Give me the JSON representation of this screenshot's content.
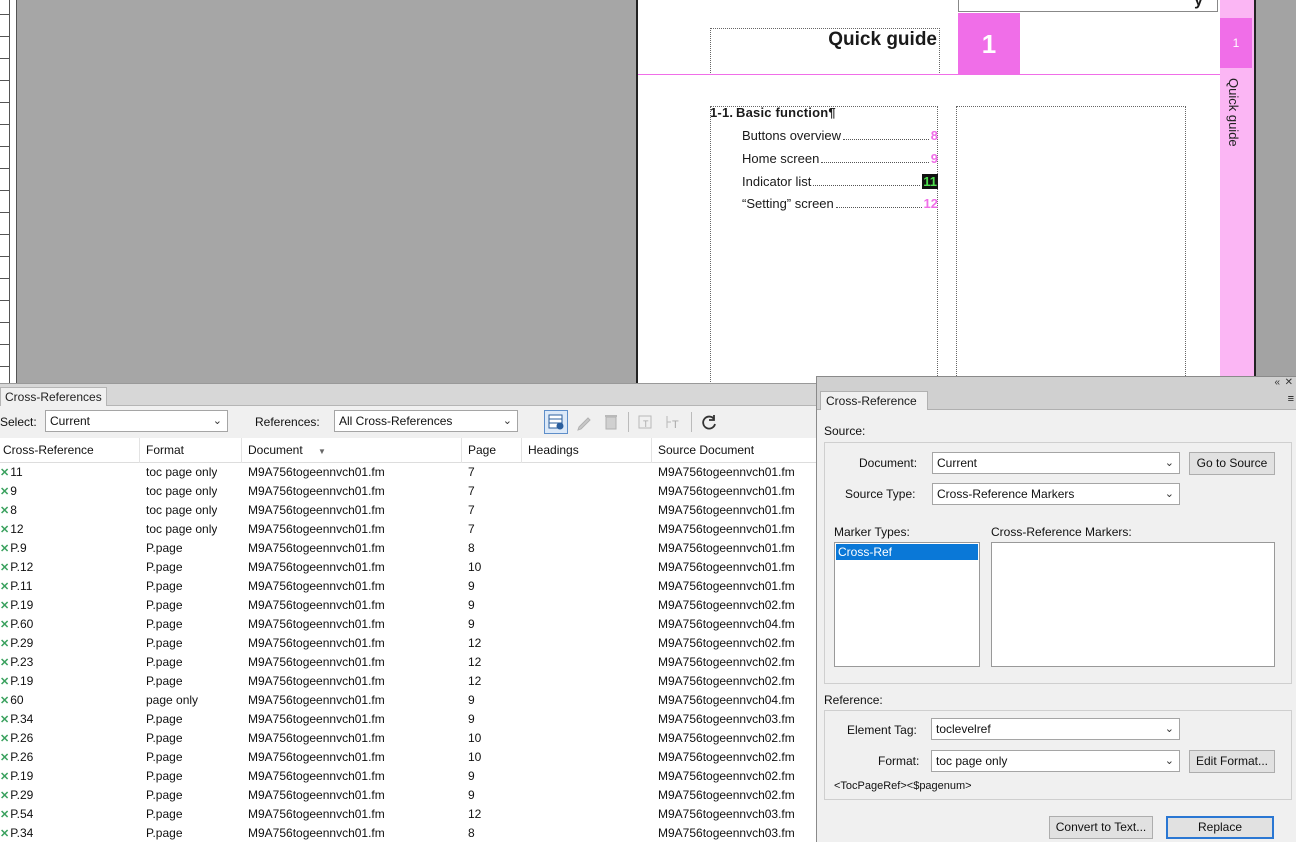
{
  "document_page": {
    "title": "Quick guide",
    "chapter_number": "1",
    "side_tab_number": "1",
    "side_tab_label": "Quick guide",
    "top_glyph": "y",
    "toc_heading": "1-1. Basic function¶",
    "toc_entries": [
      {
        "text": "Buttons overview",
        "page": "8"
      },
      {
        "text": "Home screen",
        "page": "9"
      },
      {
        "text": "Indicator list",
        "page": "11"
      },
      {
        "text": "“Setting” screen",
        "page": "12"
      }
    ]
  },
  "xref_panel": {
    "tab_label": "Cross-References",
    "select_label": "Select:",
    "select_value": "Current",
    "references_label": "References:",
    "references_value": "All Cross-References",
    "columns": [
      "Cross-Reference",
      "Format",
      "Document",
      "Page",
      "Headings",
      "Source Document"
    ],
    "rows": [
      {
        "xref": "11",
        "format": "toc page only",
        "document": "M9A756togeennvch01.fm",
        "page": "7",
        "headings": "",
        "source": "M9A756togeennvch01.fm"
      },
      {
        "xref": "9",
        "format": "toc page only",
        "document": "M9A756togeennvch01.fm",
        "page": "7",
        "headings": "",
        "source": "M9A756togeennvch01.fm"
      },
      {
        "xref": "8",
        "format": "toc page only",
        "document": "M9A756togeennvch01.fm",
        "page": "7",
        "headings": "",
        "source": "M9A756togeennvch01.fm"
      },
      {
        "xref": "12",
        "format": "toc page only",
        "document": "M9A756togeennvch01.fm",
        "page": "7",
        "headings": "",
        "source": "M9A756togeennvch01.fm"
      },
      {
        "xref": "P.9",
        "format": "P.page",
        "document": "M9A756togeennvch01.fm",
        "page": "8",
        "headings": "",
        "source": "M9A756togeennvch01.fm"
      },
      {
        "xref": "P.12",
        "format": "P.page",
        "document": "M9A756togeennvch01.fm",
        "page": "10",
        "headings": "",
        "source": "M9A756togeennvch01.fm"
      },
      {
        "xref": "P.11",
        "format": "P.page",
        "document": "M9A756togeennvch01.fm",
        "page": "9",
        "headings": "",
        "source": "M9A756togeennvch01.fm"
      },
      {
        "xref": "P.19",
        "format": "P.page",
        "document": "M9A756togeennvch01.fm",
        "page": "9",
        "headings": "",
        "source": "M9A756togeennvch02.fm"
      },
      {
        "xref": "P.60",
        "format": "P.page",
        "document": "M9A756togeennvch01.fm",
        "page": "9",
        "headings": "",
        "source": "M9A756togeennvch04.fm"
      },
      {
        "xref": "P.29",
        "format": "P.page",
        "document": "M9A756togeennvch01.fm",
        "page": "12",
        "headings": "",
        "source": "M9A756togeennvch02.fm"
      },
      {
        "xref": "P.23",
        "format": "P.page",
        "document": "M9A756togeennvch01.fm",
        "page": "12",
        "headings": "",
        "source": "M9A756togeennvch02.fm"
      },
      {
        "xref": "P.19",
        "format": "P.page",
        "document": "M9A756togeennvch01.fm",
        "page": "12",
        "headings": "",
        "source": "M9A756togeennvch02.fm"
      },
      {
        "xref": "60",
        "format": "page only",
        "document": "M9A756togeennvch01.fm",
        "page": "9",
        "headings": "",
        "source": "M9A756togeennvch04.fm"
      },
      {
        "xref": "P.34",
        "format": "P.page",
        "document": "M9A756togeennvch01.fm",
        "page": "9",
        "headings": "",
        "source": "M9A756togeennvch03.fm"
      },
      {
        "xref": "P.26",
        "format": "P.page",
        "document": "M9A756togeennvch01.fm",
        "page": "10",
        "headings": "",
        "source": "M9A756togeennvch02.fm"
      },
      {
        "xref": "P.26",
        "format": "P.page",
        "document": "M9A756togeennvch01.fm",
        "page": "10",
        "headings": "",
        "source": "M9A756togeennvch02.fm"
      },
      {
        "xref": "P.19",
        "format": "P.page",
        "document": "M9A756togeennvch01.fm",
        "page": "9",
        "headings": "",
        "source": "M9A756togeennvch02.fm"
      },
      {
        "xref": "P.29",
        "format": "P.page",
        "document": "M9A756togeennvch01.fm",
        "page": "9",
        "headings": "",
        "source": "M9A756togeennvch02.fm"
      },
      {
        "xref": "P.54",
        "format": "P.page",
        "document": "M9A756togeennvch01.fm",
        "page": "12",
        "headings": "",
        "source": "M9A756togeennvch03.fm"
      },
      {
        "xref": "P.34",
        "format": "P.page",
        "document": "M9A756togeennvch01.fm",
        "page": "8",
        "headings": "",
        "source": "M9A756togeennvch03.fm"
      }
    ]
  },
  "xref_dialog": {
    "tab_label": "Cross-Reference",
    "source_label": "Source:",
    "document_label": "Document:",
    "document_value": "Current",
    "go_to_source": "Go to Source",
    "source_type_label": "Source Type:",
    "source_type_value": "Cross-Reference Markers",
    "marker_types_label": "Marker Types:",
    "marker_types": [
      "Cross-Ref"
    ],
    "xref_markers_label": "Cross-Reference Markers:",
    "reference_label": "Reference:",
    "element_tag_label": "Element Tag:",
    "element_tag_value": "toclevelref",
    "format_label": "Format:",
    "format_value": "toc page only",
    "edit_format": "Edit Format...",
    "format_definition": "<TocPageRef><$pagenum>",
    "convert_to_text": "Convert to Text...",
    "replace": "Replace"
  },
  "colors": {
    "accent_pink": "#f06ee8",
    "side_tab_pink": "#fbb6f4",
    "selection_blue": "#0a78d7",
    "xref_marker_green": "#3aa15e"
  }
}
